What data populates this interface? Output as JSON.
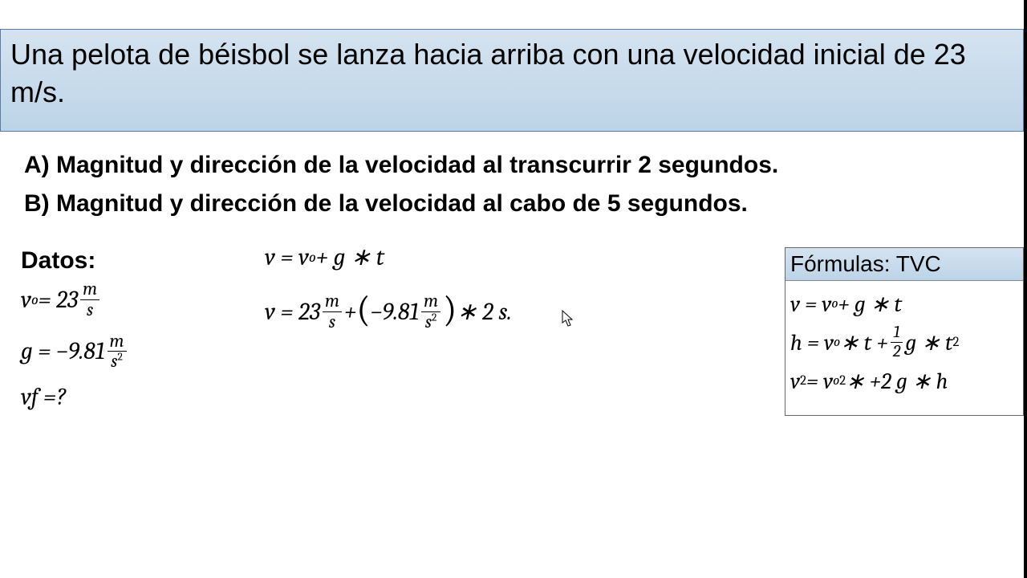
{
  "problem": {
    "statement": "Una pelota de béisbol se lanza hacia arriba con una velocidad inicial de 23 m/s."
  },
  "questions": {
    "a": "A) Magnitud y dirección de la velocidad al transcurrir 2 segundos.",
    "b": "B) Magnitud y dirección de la velocidad al cabo de 5 segundos."
  },
  "datos": {
    "title": "Datos:",
    "vo_label": "v",
    "vo_sub": "o",
    "vo_eq": " = 23 ",
    "vo_unit_num": "m",
    "vo_unit_den": "s",
    "g_label": "g = −9.81 ",
    "g_unit_num": "m",
    "g_unit_den_base": "s",
    "g_unit_den_exp": "2",
    "vf_label": "vf =?"
  },
  "work": {
    "line1_pre": "v = v",
    "line1_sub": "o",
    "line1_post": " + g ∗ t",
    "line2_a": "v = 23 ",
    "line2_u1_num": "m",
    "line2_u1_den": "s",
    "line2_b": " + ",
    "line2_lp": "(",
    "line2_c": "−9.81",
    "line2_u2_num": "m",
    "line2_u2_den_base": "s",
    "line2_u2_den_exp": "2",
    "line2_rp": ")",
    "line2_d": " ∗ 2 s."
  },
  "formulas": {
    "title": "Fórmulas: TVC",
    "f1_pre": "v = v",
    "f1_sub": "o",
    "f1_post": " + g ∗ t",
    "f2_pre": "h = v",
    "f2_sub": "o",
    "f2_mid": " ∗ t + ",
    "f2_frac_num": "1",
    "f2_frac_den": "2",
    "f2_post": " g ∗ t",
    "f2_exp": "2",
    "f3_a": "v",
    "f3_exp1": "2",
    "f3_b": " = v",
    "f3_sub": "o",
    "f3_exp2": "2",
    "f3_c": " ∗ +2 g ∗ h"
  }
}
